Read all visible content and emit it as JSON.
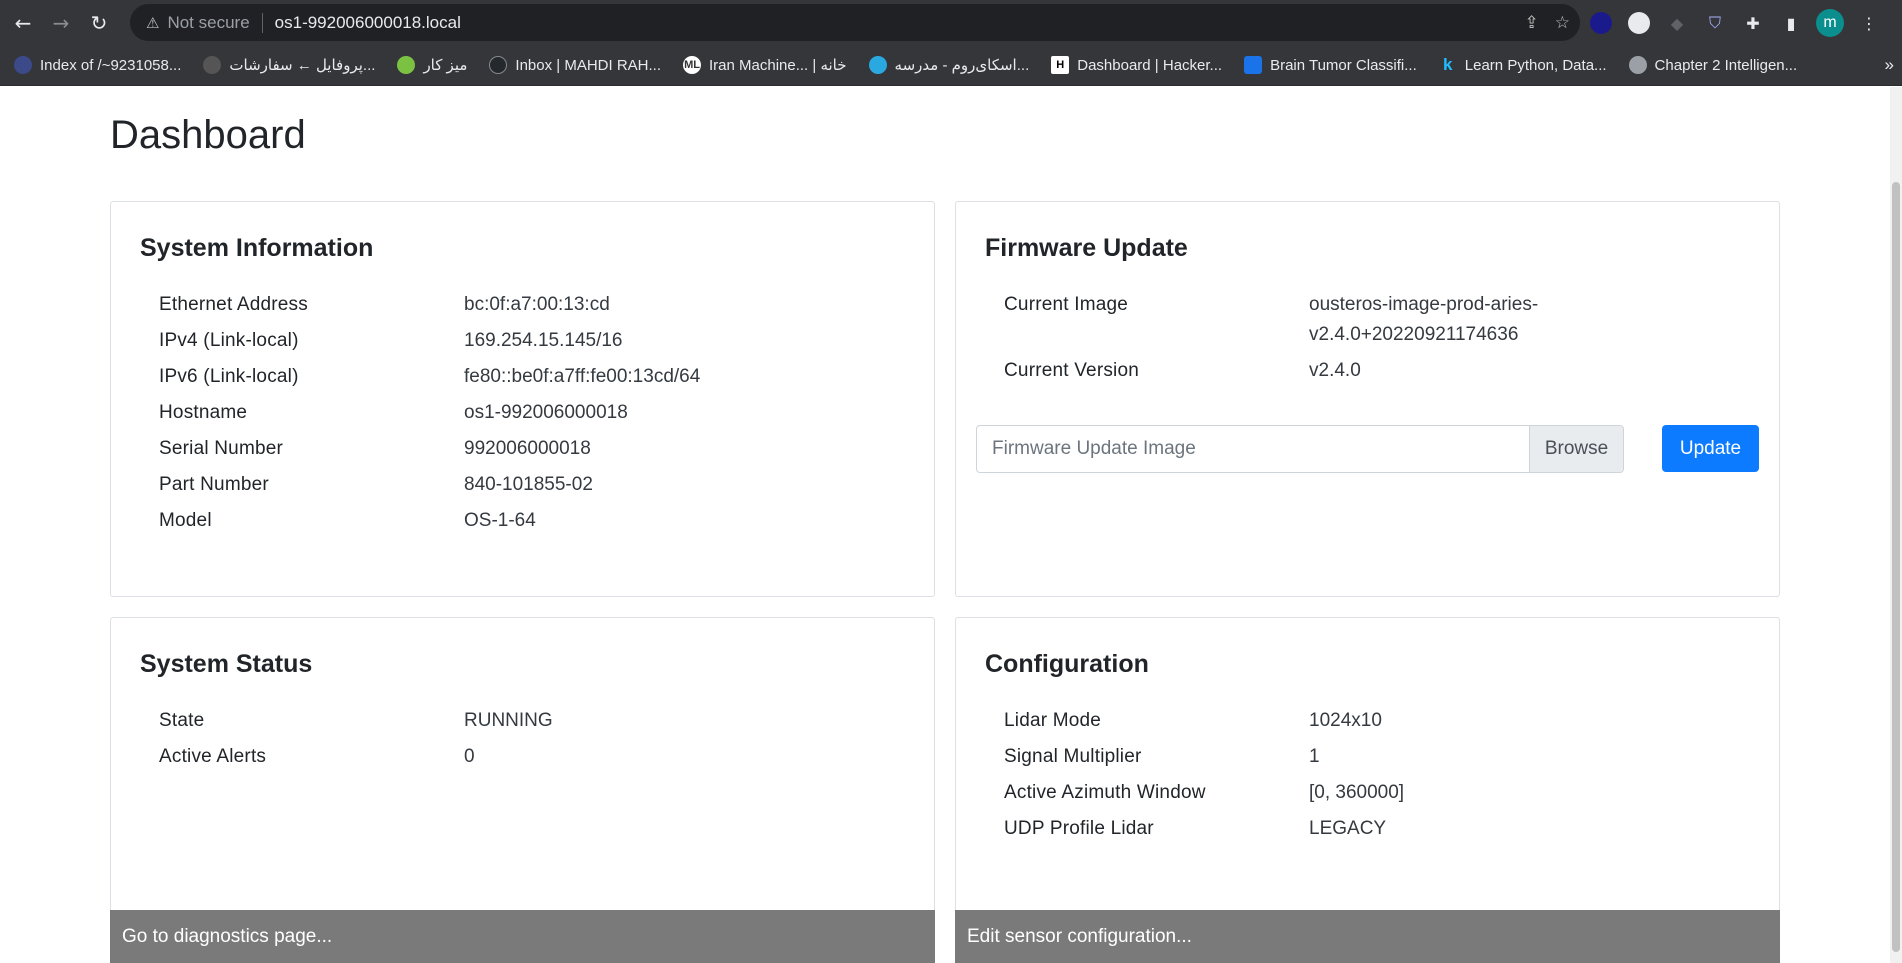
{
  "browser": {
    "security_label": "Not secure",
    "url": "os1-992006000018.local",
    "profile_initial": "m",
    "bookmarks": [
      {
        "label": "Index of /~9231058...",
        "icon": "globe-icon",
        "color": "#3c4a8a"
      },
      {
        "label": "پروفایل ← سفارشات...",
        "icon": "bookmark-icon",
        "color": "#555555"
      },
      {
        "label": "میز کار",
        "icon": "leaf-icon",
        "color": "#7cc242"
      },
      {
        "label": "Inbox | MAHDI RAH...",
        "icon": "github-icon",
        "color": "#24292e"
      },
      {
        "label": "Iran Machine... | خانه",
        "icon": "ml-icon",
        "color": "#ffffff"
      },
      {
        "label": "اسکای‌روم - مدرسه...",
        "icon": "bird-icon",
        "color": "#2aa8e0"
      },
      {
        "label": "Dashboard | Hacker...",
        "icon": "hackerrank-icon",
        "color": "#1ba94c"
      },
      {
        "label": "Brain Tumor Classifi...",
        "icon": "stack-icon",
        "color": "#1a73e8"
      },
      {
        "label": "Learn Python, Data...",
        "icon": "k-icon",
        "color": "#20beff"
      },
      {
        "label": "Chapter 2 Intelligen...",
        "icon": "globe-icon",
        "color": "#9aa0a6"
      }
    ]
  },
  "page": {
    "title": "Dashboard"
  },
  "system_information": {
    "title": "System Information",
    "rows": [
      {
        "key": "Ethernet Address",
        "value": "bc:0f:a7:00:13:cd"
      },
      {
        "key": "IPv4 (Link-local)",
        "value": "169.254.15.145/16"
      },
      {
        "key": "IPv6 (Link-local)",
        "value": "fe80::be0f:a7ff:fe00:13cd/64"
      },
      {
        "key": "Hostname",
        "value": "os1-992006000018"
      },
      {
        "key": "Serial Number",
        "value": "992006000018"
      },
      {
        "key": "Part Number",
        "value": "840-101855-02"
      },
      {
        "key": "Model",
        "value": "OS-1-64"
      }
    ]
  },
  "firmware_update": {
    "title": "Firmware Update",
    "current_image_label": "Current Image",
    "current_image_line1": "ousteros-image-prod-aries-",
    "current_image_line2": "v2.4.0+20220921174636",
    "current_version_label": "Current Version",
    "current_version": "v2.4.0",
    "file_placeholder": "Firmware Update Image",
    "browse_label": "Browse",
    "update_label": "Update"
  },
  "system_status": {
    "title": "System Status",
    "rows": [
      {
        "key": "State",
        "value": "RUNNING"
      },
      {
        "key": "Active Alerts",
        "value": "0"
      }
    ],
    "footer_link": "Go to diagnostics page..."
  },
  "configuration": {
    "title": "Configuration",
    "rows": [
      {
        "key": "Lidar Mode",
        "value": "1024x10"
      },
      {
        "key": "Signal Multiplier",
        "value": "1"
      },
      {
        "key": "Active Azimuth Window",
        "value": "[0, 360000]"
      },
      {
        "key": "UDP Profile Lidar",
        "value": "LEGACY"
      }
    ],
    "footer_link": "Edit sensor configuration..."
  }
}
